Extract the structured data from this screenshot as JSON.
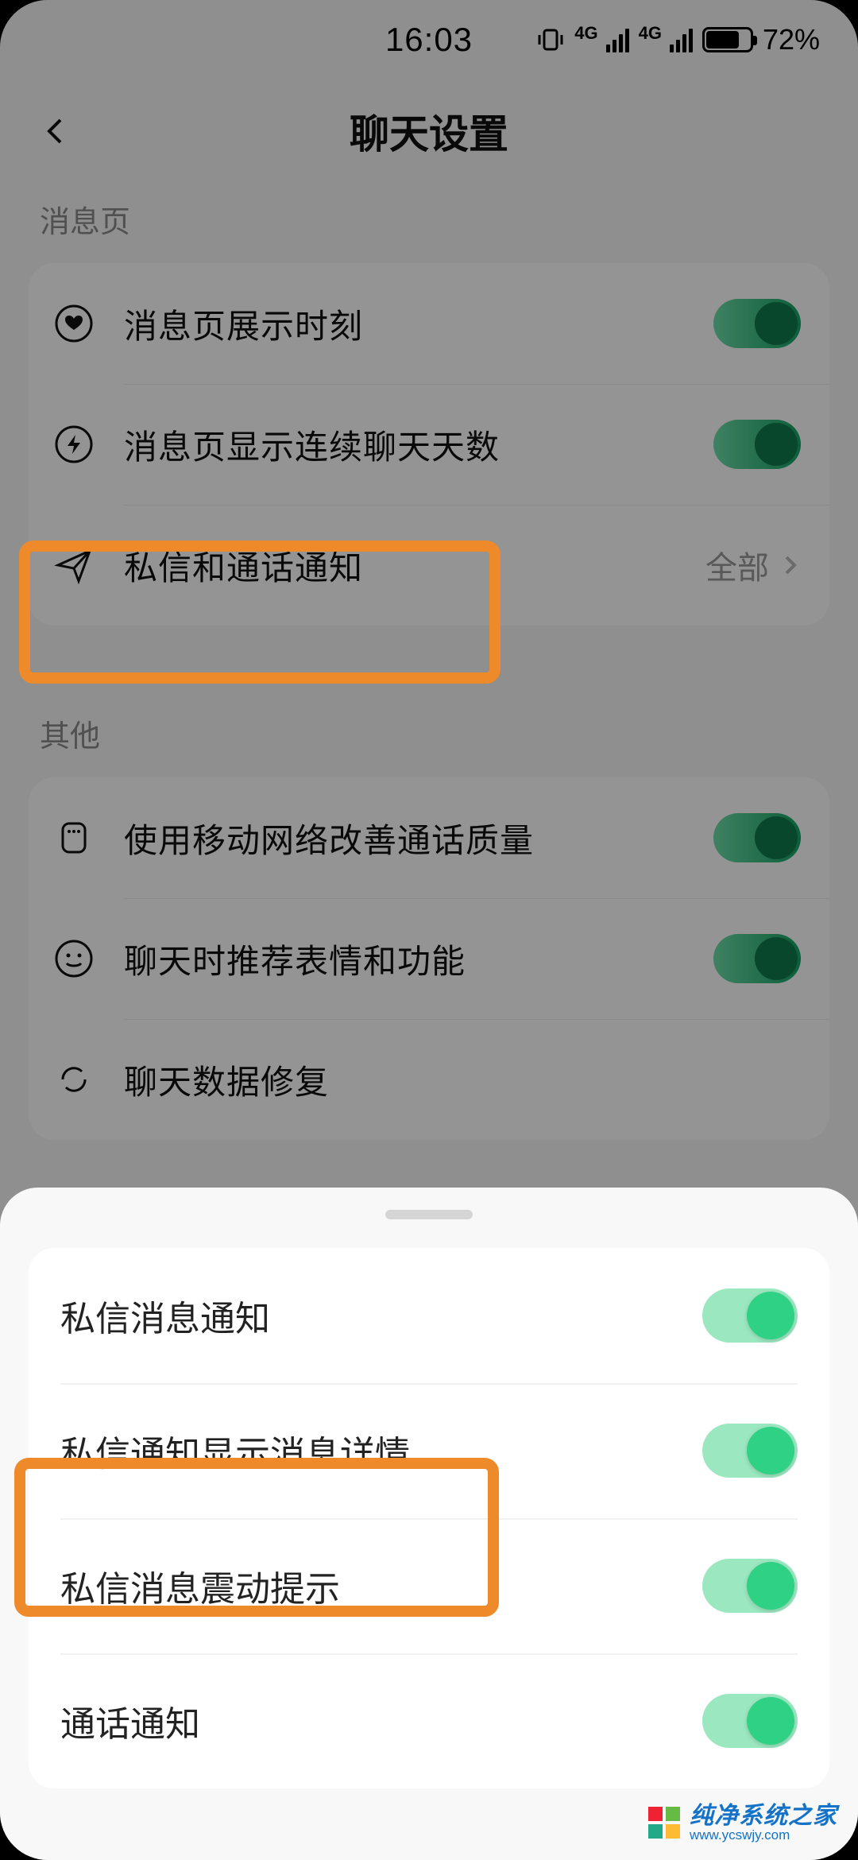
{
  "status": {
    "time": "16:03",
    "battery": "72%"
  },
  "header": {
    "title": "聊天设置"
  },
  "sections": {
    "s1_label": "消息页",
    "s2_label": "其他"
  },
  "rows": {
    "r1": "消息页展示时刻",
    "r2": "消息页显示连续聊天天数",
    "r3": "私信和通话通知",
    "r3_value": "全部",
    "r4": "使用移动网络改善通话质量",
    "r5": "聊天时推荐表情和功能",
    "r6": "聊天数据修复"
  },
  "sheet": {
    "o1": "私信消息通知",
    "o2": "私信通知显示消息详情",
    "o3": "私信消息震动提示",
    "o4": "通话通知"
  },
  "watermark": {
    "cn": "纯净系统之家",
    "url": "www.ycswjy.com"
  }
}
